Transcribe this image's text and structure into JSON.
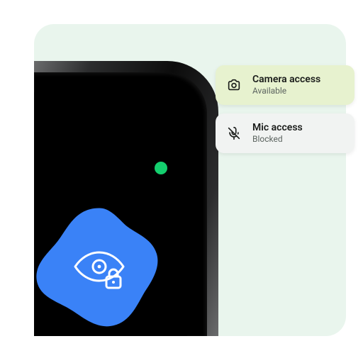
{
  "colors": {
    "bg_panel": "#e9f5ed",
    "privacy_dot": "#14cf6e",
    "badge_blue": "#3a82f7",
    "chip_camera_bg": "#e7f2cf",
    "chip_mic_bg": "#f1f3f2"
  },
  "chips": {
    "camera": {
      "icon": "camera-icon",
      "title": "Camera access",
      "status": "Available"
    },
    "mic": {
      "icon": "mic-off-icon",
      "title": "Mic access",
      "status": "Blocked"
    }
  },
  "badge": {
    "icon": "eye-lock-icon"
  },
  "privacy_indicator": {
    "icon": "privacy-dot"
  }
}
